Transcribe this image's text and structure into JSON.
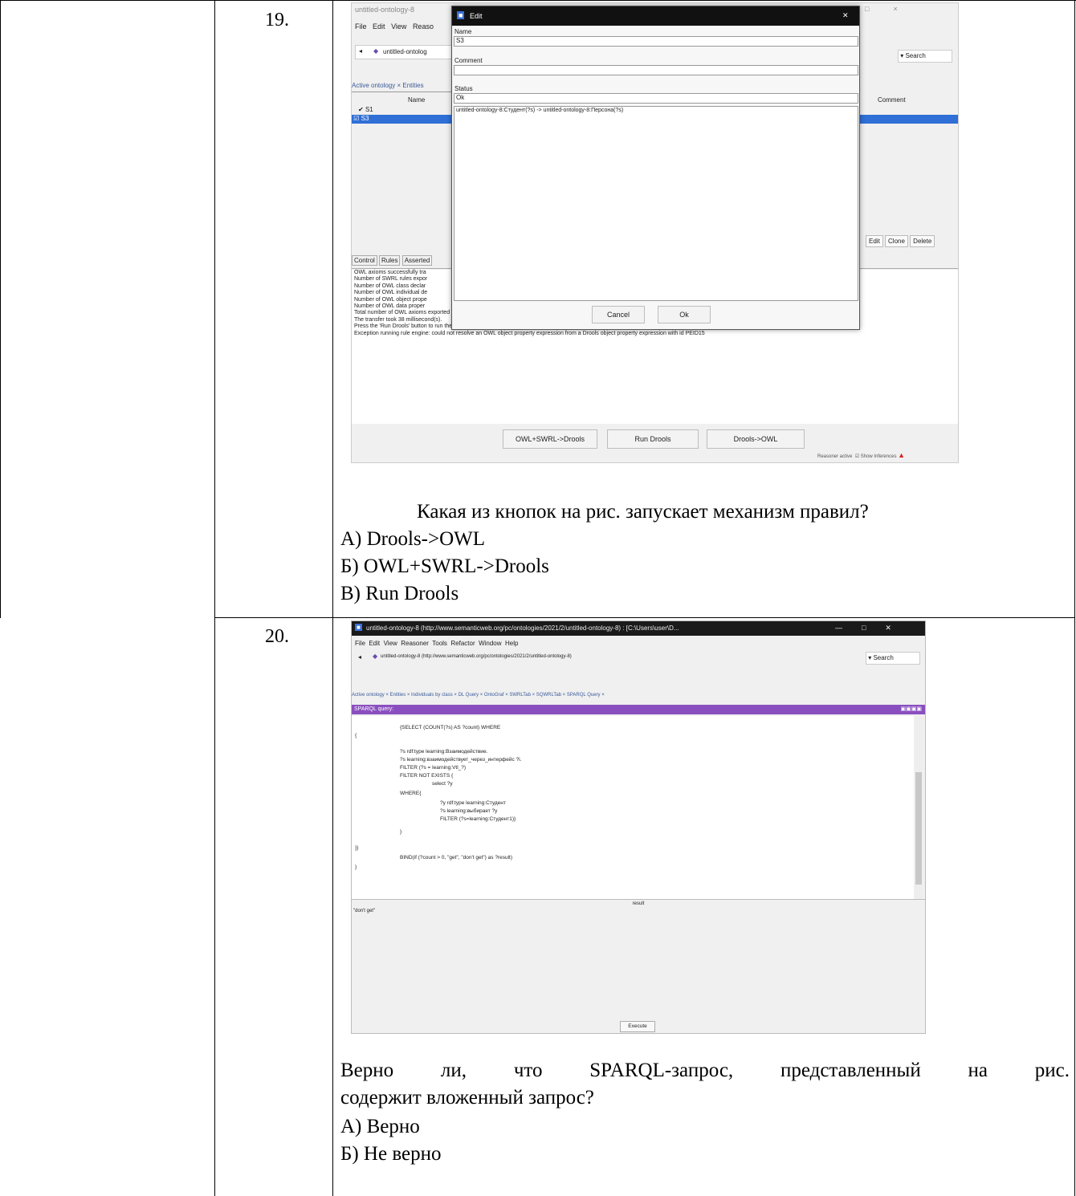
{
  "q19": {
    "number": "19.",
    "window": {
      "title": "untitled-ontology-8",
      "menu": [
        "File",
        "Edit",
        "View",
        "Reaso"
      ],
      "address": "untitled-ontolog",
      "search": "Search",
      "tabs": "Active ontology × Entities",
      "table": {
        "col_name": "Name",
        "col_comment": "Comment",
        "rows": [
          "S1",
          "S3"
        ]
      },
      "row_buttons": [
        "Edit",
        "Clone",
        "Delete"
      ],
      "bottom_tabs": [
        "Control",
        "Rules",
        "Asserted"
      ],
      "log": [
        "OWL axioms successfully tra",
        "Number of SWRL rules expor",
        "Number of OWL class declar",
        "Number of OWL individual de",
        "Number of OWL object prope",
        "Number of OWL data proper",
        "Total number of OWL axioms exported to rule engine: 263",
        "The transfer took 38 millisecond(s).",
        "Press the 'Run Drools' button to run the rule engine",
        "Exception running rule engine: could not resolve an OWL object property expression from a Drools object property expression with id PEID15"
      ],
      "engine_buttons": [
        "OWL+SWRL->Drools",
        "Run Drools",
        "Drools->OWL"
      ],
      "status": "Reasoner active",
      "show_inferences": "Show Inferences"
    },
    "dialog": {
      "title": "Edit",
      "name_label": "Name",
      "name_value": "S3",
      "comment_label": "Comment",
      "comment_value": "",
      "status_label": "Status",
      "status_value": "Ok",
      "rule": "untitled-ontology-8:Студент(?s) -> untitled-ontology-8:Персона(?s)",
      "cancel": "Cancel",
      "ok": "Ok"
    },
    "question": "Какая из кнопок  на рис. запускает механизм правил?",
    "options": [
      "А) Drools->OWL",
      "Б) OWL+SWRL->Drools",
      "В) Run Drools"
    ]
  },
  "q20": {
    "number": "20.",
    "window": {
      "title": "untitled-ontology-8 (http://www.semanticweb.org/pc/ontologies/2021/2/untitled-ontology-8) : [C:\\Users\\user\\D...",
      "menu": [
        "File",
        "Edit",
        "View",
        "Reasoner",
        "Tools",
        "Refactor",
        "Window",
        "Help"
      ],
      "address": "untitled-ontology-8 (http://www.semanticweb.org/pc/ontologies/2021/2/untitled-ontology-8)",
      "search": "Search",
      "tabs": "Active ontology × Entities × Individuals by class × DL Query × OntoGraf × SWRLTab × SQWRLTab × SPARQL Query ×",
      "panel": "SPARQL query:",
      "query": [
        "{SELECT (COUNT(?s) AS ?count) WHERE",
        "{",
        "?s rdf:type learning:Взаимодействие.",
        "?s learning:взаимодействует_через_интерфейс ?i.",
        "FILTER (?s = learning:Vtl_?)",
        "FILTER NOT EXISTS {",
        "select ?y",
        "WHERE{",
        "?y rdf:type learning:Студент",
        "?s learning:выбирает ?y",
        "FILTER (?s=learning:Студент1)}",
        "}",
        "}}",
        "BIND(if (?count > 0, \"get\", \"don't get\") as ?result)",
        "}"
      ],
      "result_header": "result",
      "result_value": "\"don't get\"",
      "execute": "Execute"
    },
    "question_line1": "Верно ли, что SPARQL-запрос, представленный на рис.",
    "question_line2": "содержит вложенный запрос?",
    "options": [
      "А)  Верно",
      "Б) Не верно"
    ]
  },
  "colors": {
    "purple": "#8a4fbf",
    "selection": "#2f6fd6",
    "bg": "#f0f0f0"
  }
}
